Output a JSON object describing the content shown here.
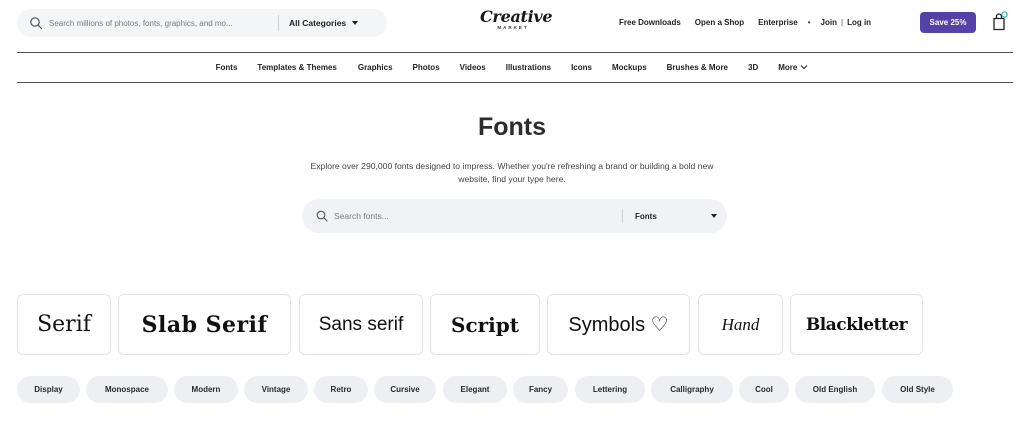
{
  "header": {
    "search_placeholder": "Search millions of photos, fonts, graphics, and mo...",
    "category_label": "All Categories",
    "logo_top": "Creative",
    "logo_bottom": "MARKET",
    "links": {
      "free_downloads": "Free Downloads",
      "open_shop": "Open a Shop",
      "enterprise": "Enterprise",
      "dot": "•",
      "join": "Join",
      "separator": "|",
      "login": "Log in"
    },
    "save_label": "Save 25%",
    "accent_color": "#5542a8",
    "cart_badge_color": "#2bb6a8"
  },
  "nav": {
    "items": [
      "Fonts",
      "Templates & Themes",
      "Graphics",
      "Photos",
      "Videos",
      "Illustrations",
      "Icons",
      "Mockups",
      "Brushes & More",
      "3D",
      "More"
    ]
  },
  "hero": {
    "title": "Fonts",
    "description": "Explore over 290,000 fonts designed to impress. Whether you're refreshing a brand or building a bold new website, find your type here.",
    "search_placeholder": "Search fonts...",
    "filter_label": "Fonts"
  },
  "styles": [
    "Serif",
    "Slab Serif",
    "Sans serif",
    "Script",
    "Symbols ♡",
    "Hand",
    "Blackletter"
  ],
  "tags": [
    "Display",
    "Monospace",
    "Modern",
    "Vintage",
    "Retro",
    "Cursive",
    "Elegant",
    "Fancy",
    "Lettering",
    "Calligraphy",
    "Cool",
    "Old English",
    "Old Style"
  ]
}
